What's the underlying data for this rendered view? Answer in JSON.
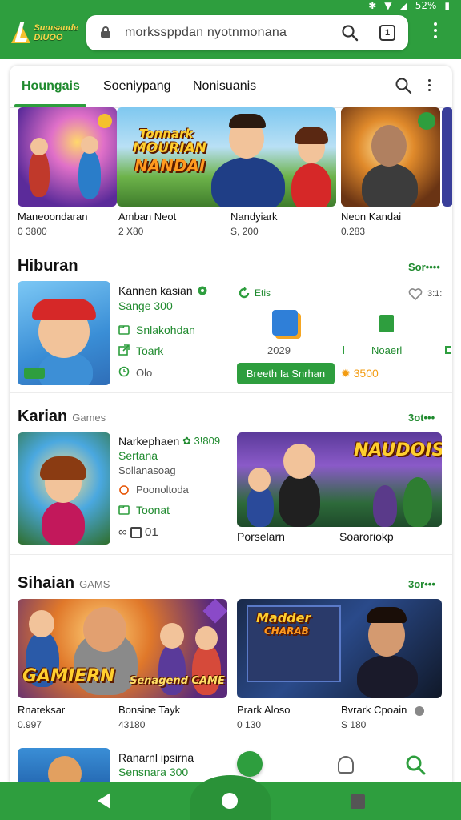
{
  "status_bar": {
    "battery": "52%"
  },
  "browser": {
    "logo_text_line1": "Sumsaude",
    "logo_text_line2": "DIUOO",
    "url": "morkssppdan nyotnmonana",
    "tab_count": "1"
  },
  "tabs": [
    {
      "label": "Houngais",
      "active": true
    },
    {
      "label": "Soeniypang",
      "active": false
    },
    {
      "label": "Nonisuanis",
      "active": false
    }
  ],
  "featured": {
    "items": [
      {
        "title": "Maneoondaran",
        "count": "0 3800"
      },
      {
        "title": "Amban Neot",
        "count": "2 X80"
      },
      {
        "title": "Nandyiark",
        "count": "S, 200"
      },
      {
        "title": "Neon Kandai",
        "count": "0.283"
      }
    ],
    "banner_title": [
      "Tonnark",
      "MOURIAN",
      "NANDAI"
    ]
  },
  "hiburan": {
    "title": "Hiburan",
    "more": "Sor••••",
    "game": {
      "name": "Kannen kasian",
      "rating": "Sange 300",
      "line1": "Snlakohdan",
      "line2": "Toark",
      "line3": "Olo",
      "badge_label": "Etis",
      "year": "2029",
      "secondary": "Noaerl",
      "button_label": "Breeth Ia Snrhan",
      "price": "3500",
      "extra": "3:1:"
    }
  },
  "karian": {
    "title": "Karian",
    "subtitle": "Games",
    "more": "3ot•••",
    "game": {
      "name": "Narkephaen",
      "score": "3!809",
      "line1": "Sertana",
      "line2": "Sollanasoag",
      "line3": "Poonoltoda",
      "line4": "Toonat",
      "line5": "01"
    },
    "wide_banner_title": "NAUDOIS",
    "captions": [
      "Porselarn",
      "Soaroriokp"
    ]
  },
  "sihaian": {
    "title": "Sihaian",
    "subtitle": "GAMS",
    "more": "3or•••",
    "banner1_title": "GAMIERN",
    "banner1_sub": "Senagend CAME",
    "banner2_title": [
      "Madder",
      "CHARAB"
    ],
    "items": [
      {
        "title": "Rnateksar",
        "count": "0.997"
      },
      {
        "title": "Bonsine Tayk",
        "count": "43180"
      },
      {
        "title": "Prark Aloso",
        "count": "0 130"
      },
      {
        "title": "Bvrark Cpoain",
        "count": "S 180"
      }
    ]
  },
  "bottom": {
    "game_name": "Ranarnl ipsirna",
    "game_sub": "Sensnara 300"
  },
  "colors": {
    "brand_green": "#2e9e3e",
    "accent_orange": "#f39c12"
  }
}
